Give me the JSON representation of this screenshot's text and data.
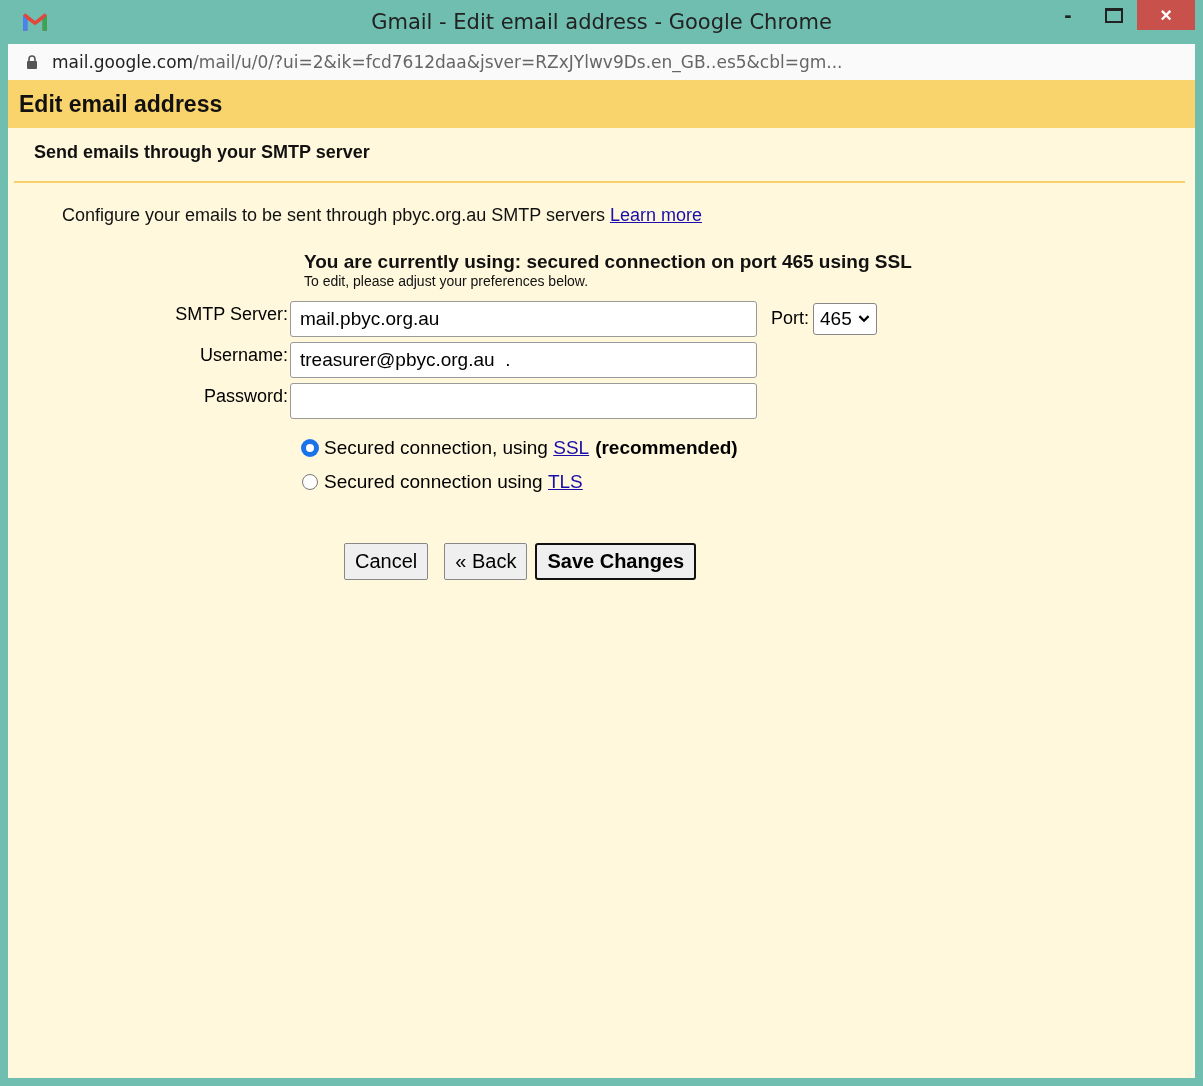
{
  "window": {
    "title": "Gmail - Edit email address - Google Chrome",
    "controls": [
      "-",
      "×"
    ]
  },
  "address_bar": {
    "host": "mail.google.com",
    "path": "/mail/u/0/?ui=2&ik=fcd7612daa&jsver=RZxJYlwv9Ds.en_GB..es5&cbl=gm..."
  },
  "header": {
    "title": "Edit email address"
  },
  "section": {
    "title": "Send emails through your SMTP server"
  },
  "intro": {
    "text": "Configure your emails to be sent through pbyc.org.au SMTP servers",
    "link": "Learn more"
  },
  "status": {
    "title": "You are currently using: secured connection on port 465 using SSL",
    "hint": "To edit, please adjust your preferences below."
  },
  "fields": [
    {
      "label": "SMTP Server:",
      "value": "mail.pbyc.org.au"
    },
    {
      "label": "Username:",
      "value": "treasurer@pbyc.org.au  ."
    },
    {
      "label": "Password:"
    }
  ],
  "port": {
    "label": "Port:",
    "value": "465"
  },
  "security_options": [
    {
      "text": "Secured connection, using ",
      "link": "SSL",
      "suffix": "(recommended)",
      "selected": true
    },
    {
      "text": "Secured connection using ",
      "link": "TLS",
      "selected": false
    }
  ],
  "buttons": [
    {
      "label": "Cancel",
      "kind": "normal"
    },
    {
      "label": "« Back",
      "kind": "normal"
    },
    {
      "label": "Save Changes",
      "kind": "default"
    }
  ]
}
